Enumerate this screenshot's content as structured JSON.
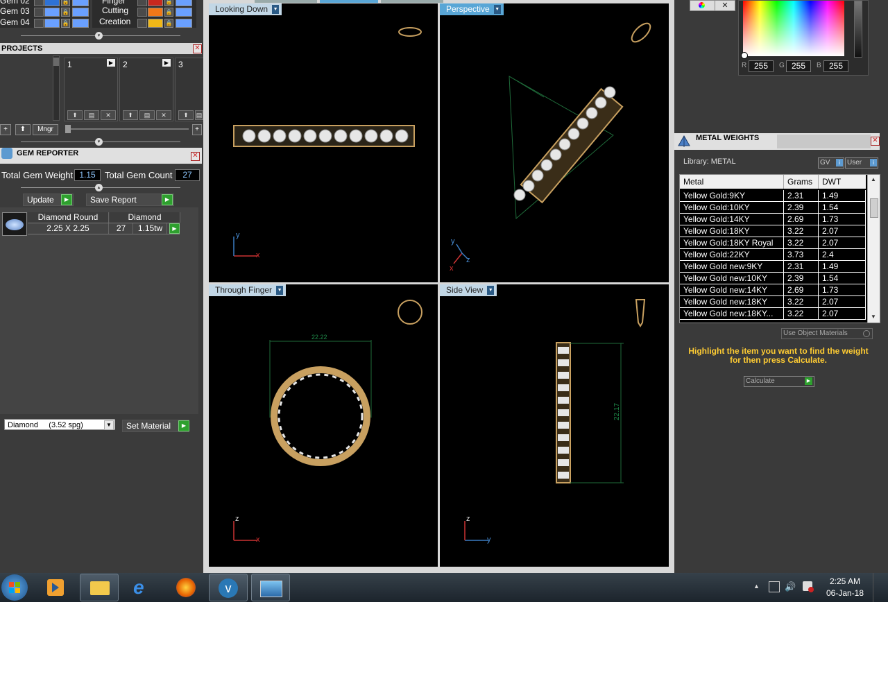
{
  "layers": {
    "rows": [
      {
        "label": "Gem 02",
        "swatch": "#2e72d6"
      },
      {
        "label": "Gem 03",
        "swatch": "#6aa0ff"
      },
      {
        "label": "Gem 04",
        "swatch": "#6aa0ff"
      }
    ],
    "right_rows": [
      {
        "label": "Finger",
        "swatch": "#c8281e"
      },
      {
        "label": "Cutting",
        "swatch": "#f07818"
      },
      {
        "label": "Creation",
        "swatch": "#f0b818"
      }
    ]
  },
  "projects": {
    "title": "PROJECTS",
    "slots": [
      "1",
      "2",
      "3"
    ],
    "mngr_label": "Mngr"
  },
  "gem_reporter": {
    "title": "GEM REPORTER",
    "total_weight_label": "Total Gem Weight",
    "total_weight_value": "1.15",
    "total_count_label": "Total Gem Count",
    "total_count_value": "27",
    "update_label": "Update",
    "save_report_label": "Save Report",
    "columns": [
      "Diamond Round",
      "Diamond"
    ],
    "row": {
      "size": "2.25 X 2.25",
      "count": "27",
      "weight": "1.15tw"
    },
    "material_select": "Diamond     (3.52 spg)",
    "set_material_label": "Set Material"
  },
  "viewports": [
    {
      "label": "Looking Down",
      "active": false,
      "axes": [
        "y",
        "x"
      ]
    },
    {
      "label": "Perspective",
      "active": true,
      "axes": [
        "y",
        "z",
        "x"
      ]
    },
    {
      "label": "Through Finger",
      "active": false,
      "axes": [
        "z",
        "x"
      ],
      "dimension": "22.22"
    },
    {
      "label": "Side View",
      "active": false,
      "axes": [
        "z",
        "y"
      ],
      "dimension": "22.17"
    }
  ],
  "color_picker": {
    "r_label": "R",
    "r_value": "255",
    "g_label": "G",
    "g_value": "255",
    "b_label": "B",
    "b_value": "255"
  },
  "metal_weights": {
    "title": "METAL WEIGHTS",
    "library_label": "Library: METAL",
    "gv_label": "GV",
    "user_label": "User",
    "columns": [
      "Metal",
      "Grams",
      "DWT"
    ],
    "rows": [
      {
        "metal": "Yellow Gold:9KY",
        "grams": "2.31",
        "dwt": "1.49"
      },
      {
        "metal": "Yellow Gold:10KY",
        "grams": "2.39",
        "dwt": "1.54"
      },
      {
        "metal": "Yellow Gold:14KY",
        "grams": "2.69",
        "dwt": "1.73"
      },
      {
        "metal": "Yellow Gold:18KY",
        "grams": "3.22",
        "dwt": "2.07"
      },
      {
        "metal": "Yellow Gold:18KY Royal",
        "grams": "3.22",
        "dwt": "2.07"
      },
      {
        "metal": "Yellow Gold:22KY",
        "grams": "3.73",
        "dwt": "2.4"
      },
      {
        "metal": "Yellow Gold new:9KY",
        "grams": "2.31",
        "dwt": "1.49"
      },
      {
        "metal": "Yellow Gold new:10KY",
        "grams": "2.39",
        "dwt": "1.54"
      },
      {
        "metal": "Yellow Gold new:14KY",
        "grams": "2.69",
        "dwt": "1.73"
      },
      {
        "metal": "Yellow Gold new:18KY",
        "grams": "3.22",
        "dwt": "2.07"
      },
      {
        "metal": "Yellow Gold new:18KY...",
        "grams": "3.22",
        "dwt": "2.07"
      }
    ],
    "use_object_materials_label": "Use Object Materials",
    "hint": "Highlight the item you want to find the weight for then press Calculate.",
    "calculate_label": "Calculate"
  },
  "taskbar": {
    "time": "2:25 AM",
    "date": "06-Jan-18"
  },
  "colors": {
    "panel": "#3a3a3a",
    "accent_green": "#2ea02e",
    "hint_yellow": "#ffcc33",
    "ring_gold": "#c8a060"
  }
}
